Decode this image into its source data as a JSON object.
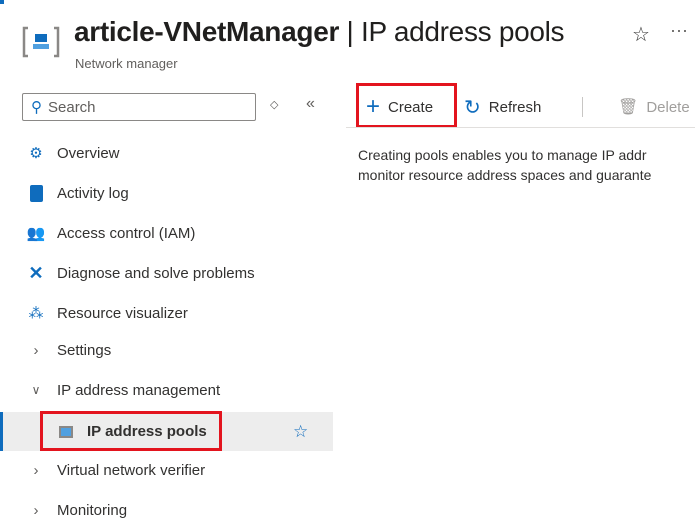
{
  "header": {
    "resource_name": "article-VNetManager",
    "page": "IP address pools",
    "separator": " | ",
    "subtitle": "Network manager",
    "favorite_icon": "star-icon",
    "more_icon": "ellipsis-icon"
  },
  "sidebar": {
    "search_placeholder": "Search",
    "items": [
      {
        "label": "Overview",
        "icon": "overview-icon"
      },
      {
        "label": "Activity log",
        "icon": "activity-log-icon"
      },
      {
        "label": "Access control (IAM)",
        "icon": "iam-icon"
      },
      {
        "label": "Diagnose and solve problems",
        "icon": "wrench-icon"
      },
      {
        "label": "Resource visualizer",
        "icon": "visualizer-icon"
      },
      {
        "label": "Settings",
        "icon": "chevron-right-icon"
      },
      {
        "label": "IP address management",
        "icon": "chevron-down-icon"
      },
      {
        "label": "IP address pools",
        "icon": "ip-pool-icon",
        "selected": true
      },
      {
        "label": "Virtual network verifier",
        "icon": "chevron-right-icon"
      },
      {
        "label": "Monitoring",
        "icon": "chevron-right-icon"
      }
    ]
  },
  "toolbar": {
    "create": "Create",
    "refresh": "Refresh",
    "delete": "Delete"
  },
  "content": {
    "line1": "Creating pools enables you to manage IP addr",
    "line2": "monitor resource address spaces and guarante"
  },
  "colors": {
    "highlight": "#e3141e",
    "accent": "#0f6cbd"
  }
}
